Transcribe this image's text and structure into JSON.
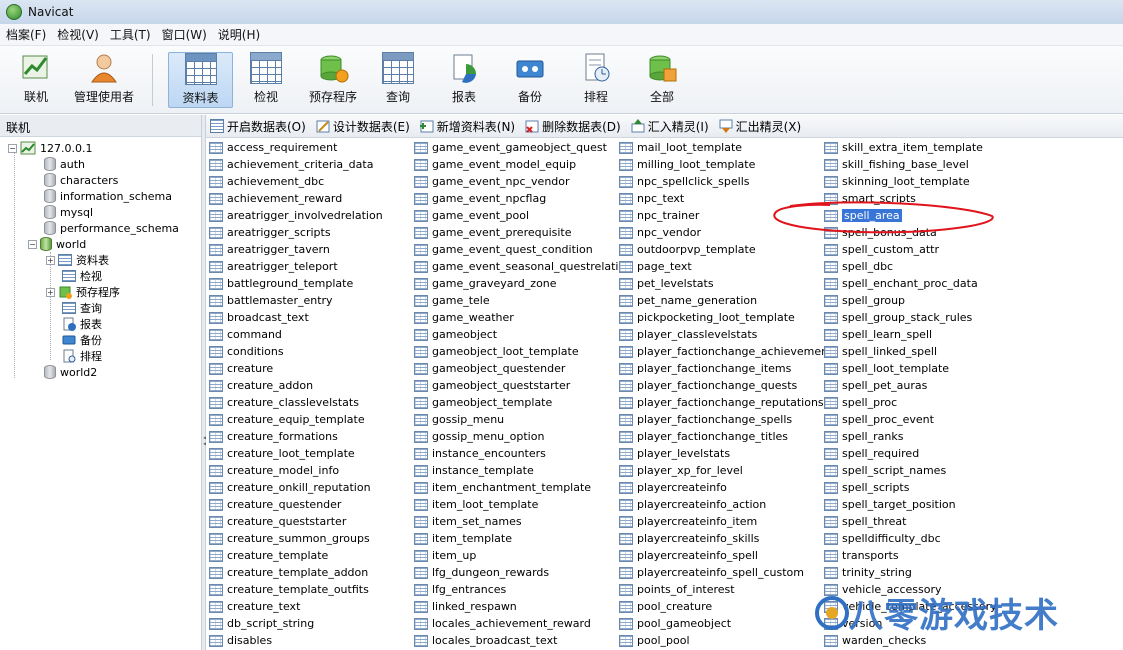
{
  "window": {
    "title": "Navicat"
  },
  "menu": [
    "档案(F)",
    "检视(V)",
    "工具(T)",
    "窗口(W)",
    "说明(H)"
  ],
  "toolbar": [
    {
      "label": "联机",
      "icon": "connection-icon"
    },
    {
      "label": "管理使用者",
      "icon": "user-icon"
    },
    {
      "label": "资料表",
      "icon": "table-icon",
      "selected": true
    },
    {
      "label": "检视",
      "icon": "view-icon"
    },
    {
      "label": "预存程序",
      "icon": "function-icon"
    },
    {
      "label": "查询",
      "icon": "query-icon"
    },
    {
      "label": "报表",
      "icon": "report-icon"
    },
    {
      "label": "备份",
      "icon": "backup-icon"
    },
    {
      "label": "排程",
      "icon": "schedule-icon"
    },
    {
      "label": "全部",
      "icon": "all-icon"
    }
  ],
  "left_panel": {
    "header": "联机",
    "connection": "127.0.0.1",
    "databases": [
      "auth",
      "characters",
      "information_schema",
      "mysql",
      "performance_schema",
      "world",
      "world2"
    ],
    "world_children": [
      "资料表",
      "检视",
      "预存程序",
      "查询",
      "报表",
      "备份",
      "排程"
    ]
  },
  "object_toolbar": [
    {
      "label": "开启数据表(O)",
      "icon": "open-table-icon"
    },
    {
      "label": "设计数据表(E)",
      "icon": "design-table-icon"
    },
    {
      "label": "新增资料表(N)",
      "icon": "new-table-icon"
    },
    {
      "label": "删除数据表(D)",
      "icon": "delete-table-icon"
    },
    {
      "label": "汇入精灵(I)",
      "icon": "import-icon"
    },
    {
      "label": "汇出精灵(X)",
      "icon": "export-icon"
    }
  ],
  "tables": {
    "selected": "spell_area",
    "columns": [
      [
        "access_requirement",
        "achievement_criteria_data",
        "achievement_dbc",
        "achievement_reward",
        "areatrigger_involvedrelation",
        "areatrigger_scripts",
        "areatrigger_tavern",
        "areatrigger_teleport",
        "battleground_template",
        "battlemaster_entry",
        "broadcast_text",
        "command",
        "conditions",
        "creature",
        "creature_addon",
        "creature_classlevelstats",
        "creature_equip_template",
        "creature_formations",
        "creature_loot_template",
        "creature_model_info",
        "creature_onkill_reputation",
        "creature_questender",
        "creature_queststarter",
        "creature_summon_groups",
        "creature_template",
        "creature_template_addon",
        "creature_template_outfits",
        "creature_text",
        "db_script_string",
        "disables"
      ],
      [
        "game_event_gameobject_quest",
        "game_event_model_equip",
        "game_event_npc_vendor",
        "game_event_npcflag",
        "game_event_pool",
        "game_event_prerequisite",
        "game_event_quest_condition",
        "game_event_seasonal_questrelation",
        "game_graveyard_zone",
        "game_tele",
        "game_weather",
        "gameobject",
        "gameobject_loot_template",
        "gameobject_questender",
        "gameobject_queststarter",
        "gameobject_template",
        "gossip_menu",
        "gossip_menu_option",
        "instance_encounters",
        "instance_template",
        "item_enchantment_template",
        "item_loot_template",
        "item_set_names",
        "item_template",
        "item_up",
        "lfg_dungeon_rewards",
        "lfg_entrances",
        "linked_respawn",
        "locales_achievement_reward",
        "locales_broadcast_text"
      ],
      [
        "mail_loot_template",
        "milling_loot_template",
        "npc_spellclick_spells",
        "npc_text",
        "npc_trainer",
        "npc_vendor",
        "outdoorpvp_template",
        "page_text",
        "pet_levelstats",
        "pet_name_generation",
        "pickpocketing_loot_template",
        "player_classlevelstats",
        "player_factionchange_achievement",
        "player_factionchange_items",
        "player_factionchange_quests",
        "player_factionchange_reputations",
        "player_factionchange_spells",
        "player_factionchange_titles",
        "player_levelstats",
        "player_xp_for_level",
        "playercreateinfo",
        "playercreateinfo_action",
        "playercreateinfo_item",
        "playercreateinfo_skills",
        "playercreateinfo_spell",
        "playercreateinfo_spell_custom",
        "points_of_interest",
        "pool_creature",
        "pool_gameobject",
        "pool_pool"
      ],
      [
        "skill_extra_item_template",
        "skill_fishing_base_level",
        "skinning_loot_template",
        "smart_scripts",
        "spell_area",
        "spell_bonus_data",
        "spell_custom_attr",
        "spell_dbc",
        "spell_enchant_proc_data",
        "spell_group",
        "spell_group_stack_rules",
        "spell_learn_spell",
        "spell_linked_spell",
        "spell_loot_template",
        "spell_pet_auras",
        "spell_proc",
        "spell_proc_event",
        "spell_ranks",
        "spell_required",
        "spell_script_names",
        "spell_scripts",
        "spell_target_position",
        "spell_threat",
        "spelldifficulty_dbc",
        "transports",
        "trinity_string",
        "vehicle_accessory",
        "vehicle_template_accessory",
        "version",
        "warden_checks"
      ]
    ]
  },
  "watermark": "八零游戏技术",
  "colors": {
    "selection": "#3875d7",
    "annotation": "#e0141c",
    "watermark": "#2f6fc4"
  }
}
